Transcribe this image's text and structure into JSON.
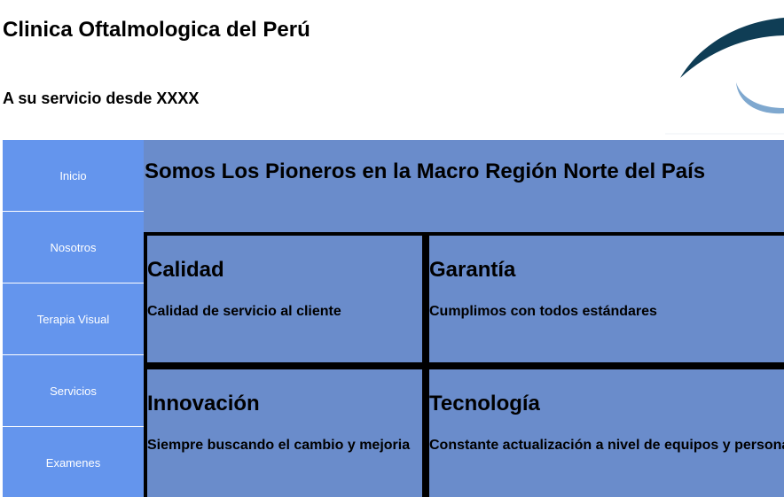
{
  "header": {
    "title": "Clinica Oftalmologica del Perú",
    "subtitle": "A su servicio desde XXXX"
  },
  "logo": {
    "icon": "eye-arc-logo",
    "colors": {
      "dark_arc": "#0f3d55",
      "light_arc": "#7fa8cf"
    }
  },
  "colors": {
    "sidebar": "#6495ed",
    "main": "#6a8ccb",
    "border": "#000000",
    "nav_text": "#ffffff"
  },
  "sidebar": {
    "items": [
      {
        "label": "Inicio"
      },
      {
        "label": "Nosotros"
      },
      {
        "label": "Terapia Visual"
      },
      {
        "label": "Servicios"
      },
      {
        "label": "Examenes"
      }
    ]
  },
  "main": {
    "heading": "Somos Los Pioneros en la Macro Región Norte del País",
    "features": [
      {
        "title": "Calidad",
        "text": "Calidad de servicio al cliente"
      },
      {
        "title": "Garantía",
        "text": "Cumplimos con todos estándares"
      },
      {
        "title": "Innovación",
        "text": "Siempre buscando el cambio y mejoria"
      },
      {
        "title": "Tecnología",
        "text": "Constante actualización a nivel de equipos y personal"
      }
    ]
  }
}
